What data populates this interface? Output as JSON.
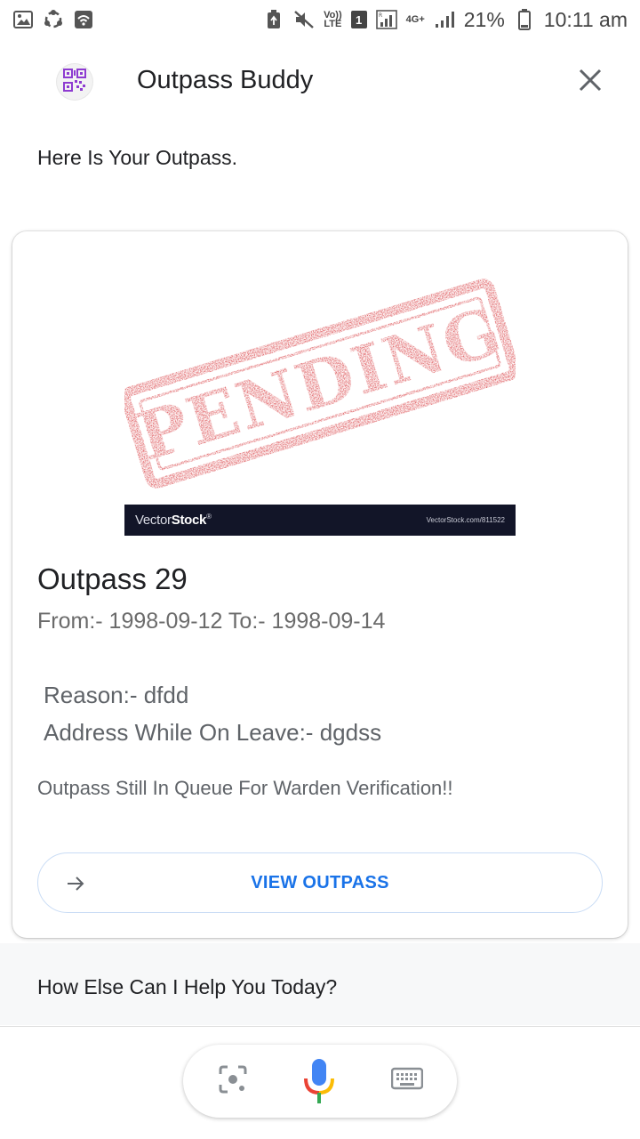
{
  "status_bar": {
    "network_label_top": "Vo))",
    "network_label_bottom": "LTE",
    "sim_slot": "1",
    "data_type": "4G+",
    "battery": "21%",
    "time": "10:11 am"
  },
  "header": {
    "title": "Outpass Buddy",
    "avatar_icon": "qr-code-icon",
    "close_icon": "close-icon"
  },
  "intro_text": "Here Is Your Outpass.",
  "card": {
    "stamp_text": "PENDING",
    "watermark_brand_light": "Vector",
    "watermark_brand_bold": "Stock",
    "watermark_registered": "®",
    "watermark_url": "VectorStock.com/811522",
    "title": "Outpass 29",
    "dates": "From:- 1998-09-12 To:- 1998-09-14",
    "reason": "Reason:- dfdd",
    "address": "Address While On Leave:- dgdss",
    "status": "Outpass Still In Queue For Warden Verification!!",
    "button_label": "VIEW OUTPASS",
    "button_icon": "arrow-right-icon"
  },
  "help_text": "How Else Can I Help You Today?",
  "input_bar": {
    "lens_icon": "lens-icon",
    "mic_icon": "microphone-icon",
    "keyboard_icon": "keyboard-icon"
  },
  "colors": {
    "accent": "#1a73e8",
    "stamp_red": "#d42a2f",
    "watermark_bar": "#121528"
  }
}
